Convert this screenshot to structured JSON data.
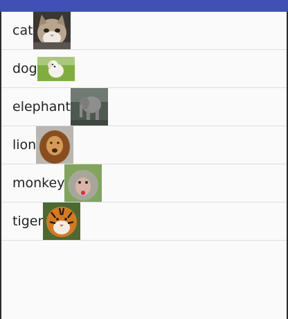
{
  "animals": [
    {
      "label": "cat",
      "photo": "cat-photo"
    },
    {
      "label": "dog",
      "photo": "dog-photo"
    },
    {
      "label": "elephant",
      "photo": "elephant-photo"
    },
    {
      "label": "lion",
      "photo": "lion-photo"
    },
    {
      "label": "monkey",
      "photo": "monkey-photo"
    },
    {
      "label": "tiger",
      "photo": "tiger-photo"
    }
  ],
  "colors": {
    "app_bar": "#3f51b5",
    "background": "#fafafa",
    "divider": "#dcdcdc"
  }
}
